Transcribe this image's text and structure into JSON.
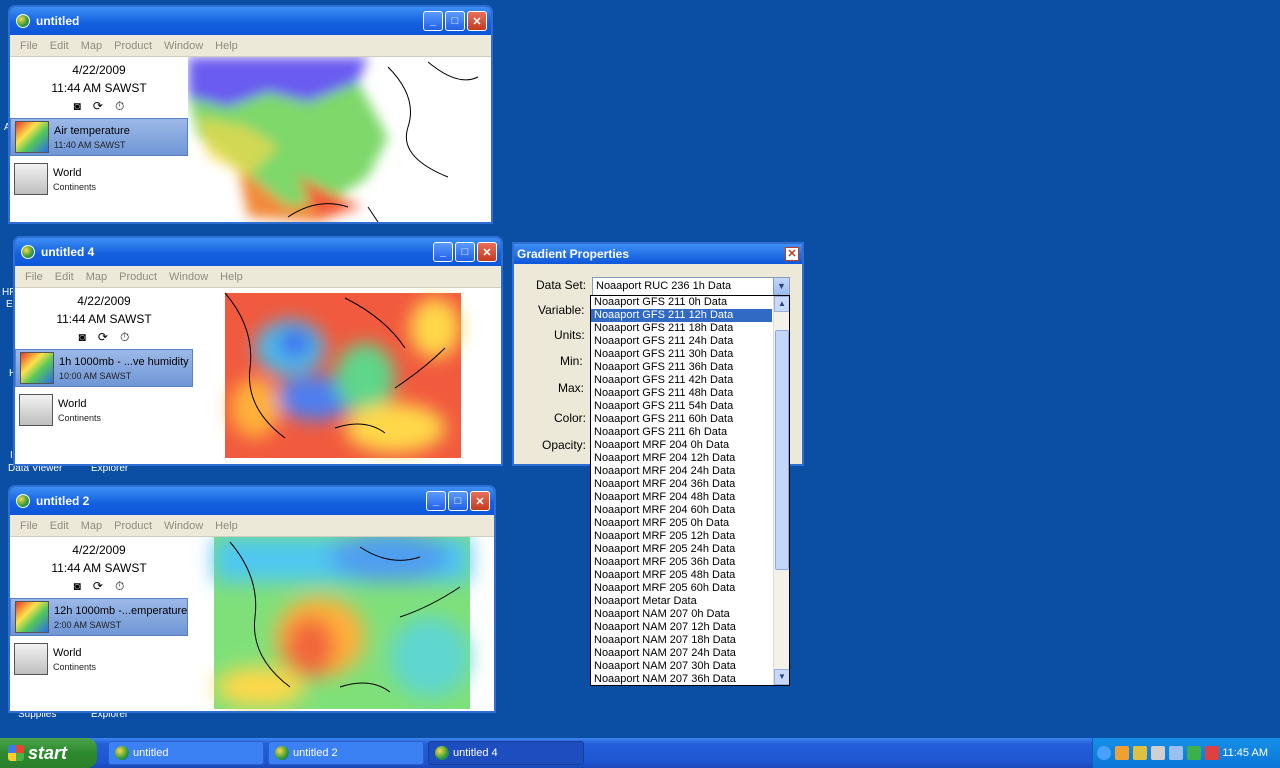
{
  "desktop": {
    "labels": [
      "A",
      "HF",
      "E",
      "H",
      "I",
      "Data Viewer",
      "Explorer",
      "Supplies",
      "Explorer"
    ]
  },
  "windows": [
    {
      "title": "untitled",
      "date": "4/22/2009",
      "time": "11:44 AM SAWST",
      "layer1_name": "Air temperature",
      "layer1_time": "11:40 AM SAWST",
      "layer2_name": "World",
      "layer2_sub": "Continents"
    },
    {
      "title": "untitled 4",
      "date": "4/22/2009",
      "time": "11:44 AM SAWST",
      "layer1_name": "1h 1000mb - ...ve humidity",
      "layer1_time": "10:00 AM SAWST",
      "layer2_name": "World",
      "layer2_sub": "Continents"
    },
    {
      "title": "untitled 2",
      "date": "4/22/2009",
      "time": "11:44 AM SAWST",
      "layer1_name": "12h 1000mb -...emperature",
      "layer1_time": "2:00 AM SAWST",
      "layer2_name": "World",
      "layer2_sub": "Continents"
    }
  ],
  "menu": [
    "File",
    "Edit",
    "Map",
    "Product",
    "Window",
    "Help"
  ],
  "dialog": {
    "title": "Gradient Properties",
    "labels": {
      "dataset": "Data Set:",
      "variable": "Variable:",
      "units": "Units:",
      "min": "Min:",
      "max": "Max:",
      "color": "Color:",
      "opacity": "Opacity:"
    },
    "dataset_value": "Noaaport RUC 236 1h Data",
    "options": [
      "Noaaport GFS 211 0h Data",
      "Noaaport GFS 211 12h Data",
      "Noaaport GFS 211 18h Data",
      "Noaaport GFS 211 24h Data",
      "Noaaport GFS 211 30h Data",
      "Noaaport GFS 211 36h Data",
      "Noaaport GFS 211 42h Data",
      "Noaaport GFS 211 48h Data",
      "Noaaport GFS 211 54h Data",
      "Noaaport GFS 211 60h Data",
      "Noaaport GFS 211 6h Data",
      "Noaaport MRF 204 0h Data",
      "Noaaport MRF 204 12h Data",
      "Noaaport MRF 204 24h Data",
      "Noaaport MRF 204 36h Data",
      "Noaaport MRF 204 48h Data",
      "Noaaport MRF 204 60h Data",
      "Noaaport MRF 205 0h Data",
      "Noaaport MRF 205 12h Data",
      "Noaaport MRF 205 24h Data",
      "Noaaport MRF 205 36h Data",
      "Noaaport MRF 205 48h Data",
      "Noaaport MRF 205 60h Data",
      "Noaaport Metar Data",
      "Noaaport NAM 207 0h Data",
      "Noaaport NAM 207 12h Data",
      "Noaaport NAM 207 18h Data",
      "Noaaport NAM 207 24h Data",
      "Noaaport NAM 207 30h Data",
      "Noaaport NAM 207 36h Data"
    ],
    "selected_index": 1
  },
  "taskbar": {
    "start": "start",
    "buttons": [
      "untitled",
      "untitled 2",
      "untitled 4"
    ],
    "active": "untitled 4",
    "clock": "11:45 AM"
  }
}
